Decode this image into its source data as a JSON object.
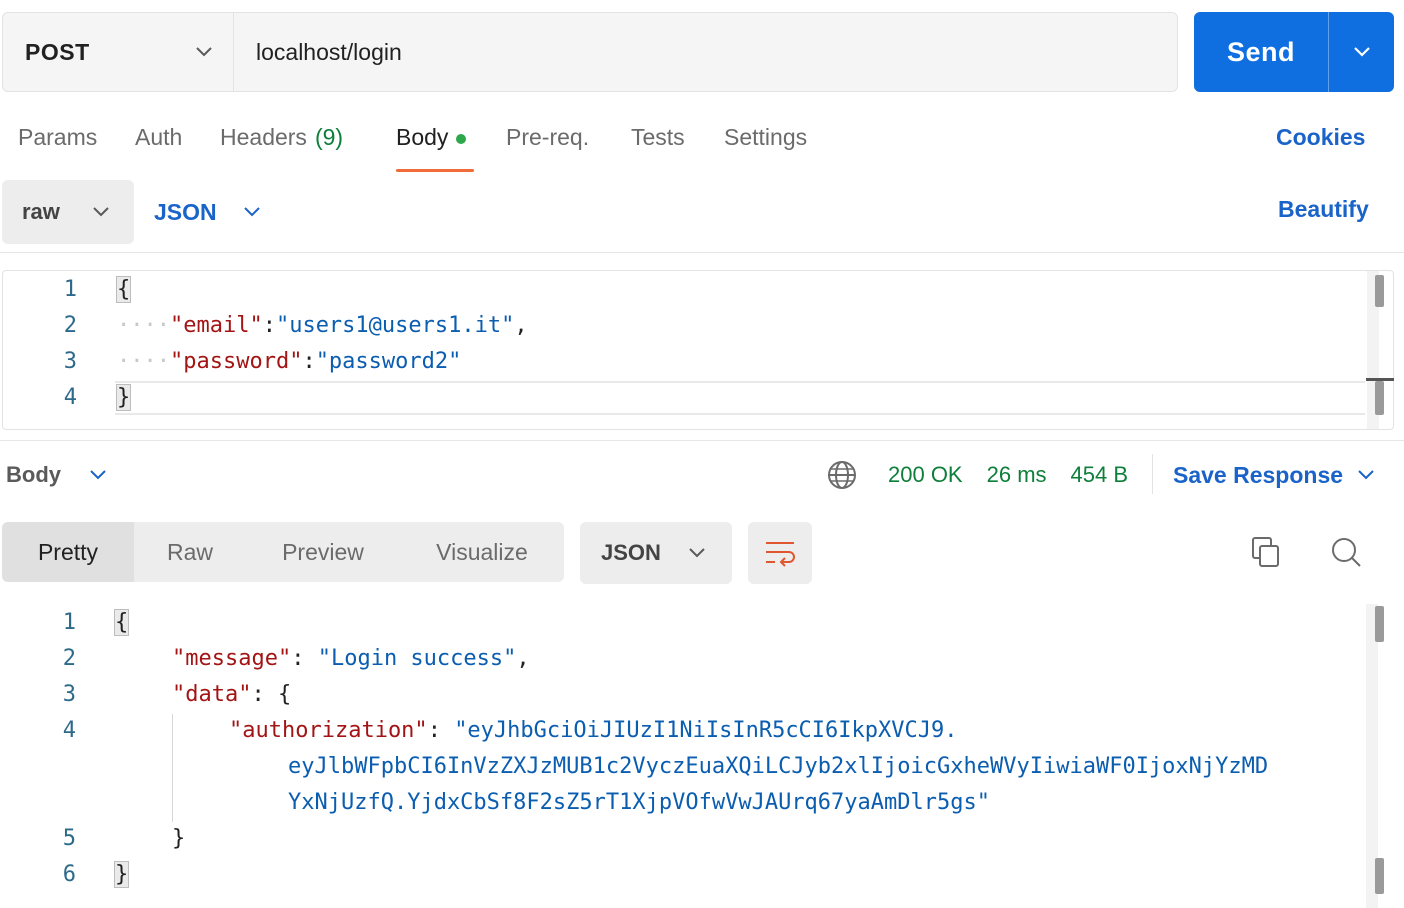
{
  "request": {
    "method": "POST",
    "url": "localhost/login",
    "send_label": "Send"
  },
  "tabs": [
    {
      "label": "Params",
      "active": false
    },
    {
      "label": "Auth",
      "active": false
    },
    {
      "label": "Headers",
      "count": "(9)",
      "active": false
    },
    {
      "label": "Body",
      "active": true,
      "indicator": "green-dot"
    },
    {
      "label": "Pre-req.",
      "active": false
    },
    {
      "label": "Tests",
      "active": false
    },
    {
      "label": "Settings",
      "active": false
    }
  ],
  "cookies_label": "Cookies",
  "body_options": {
    "mode": "raw",
    "language": "JSON",
    "beautify_label": "Beautify"
  },
  "request_body": {
    "line_numbers": [
      "1",
      "2",
      "3",
      "4"
    ],
    "lines": [
      "{",
      "\"email\":\"users1@users1.it\",",
      "\"password\":\"password2\"",
      "}"
    ],
    "email_key": "\"email\"",
    "email_value": "\"users1@users1.it\"",
    "password_key": "\"password\"",
    "password_value": "\"password2\""
  },
  "response": {
    "section_label": "Body",
    "status": "200 OK",
    "time": "26 ms",
    "size": "454 B",
    "save_label": "Save Response",
    "views": [
      "Pretty",
      "Raw",
      "Preview",
      "Visualize"
    ],
    "active_view": "Pretty",
    "format": "JSON",
    "line_numbers": [
      "1",
      "2",
      "3",
      "4",
      "5",
      "6"
    ],
    "message_key": "\"message\"",
    "message_value": "\"Login success\"",
    "data_key": "\"data\"",
    "authorization_key": "\"authorization\"",
    "authorization_value_lines": [
      "\"eyJhbGciOiJIUzI1NiIsInR5cCI6IkpXVCJ9.",
      "eyJlbWFpbCI6InVzZXJzMUB1c2VyczEuaXQiLCJyb2xlIjoicGxheWVyIiwiaWF0IjoxNjYzMD",
      "YxNjUzfQ.YjdxCbSf8F2sZ5rT1XjpVOfwVwJAUrq67yaAmDlr5gs\""
    ]
  },
  "colors": {
    "accent_blue": "#0f6fe0",
    "link_blue": "#1a63c8",
    "active_tab_underline": "#f26b3a",
    "status_green": "#0e7f3a",
    "json_key": "#a31515",
    "json_string": "#0b5db0"
  },
  "icons": [
    "chevron-down-icon",
    "globe-icon",
    "wrap-lines-icon",
    "copy-icon",
    "search-icon"
  ]
}
